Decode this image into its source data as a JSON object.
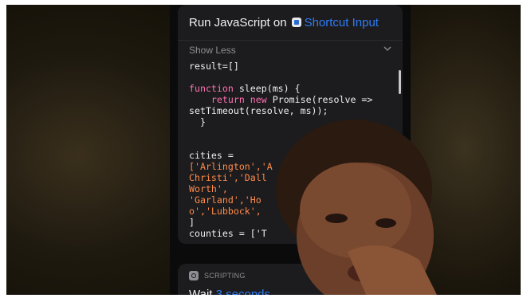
{
  "action": {
    "title_prefix": "Run JavaScript on",
    "input_icon": "shortcut-input-icon",
    "input_label": "Shortcut Input",
    "toggle_label": "Show Less",
    "toggle_icon": "chevron-down-icon"
  },
  "code": {
    "lines": [
      [
        {
          "t": "result=[]"
        }
      ],
      [
        {
          "t": ""
        }
      ],
      [
        {
          "t": "function",
          "c": "kw"
        },
        {
          "t": " sleep(ms) {"
        }
      ],
      [
        {
          "t": "    "
        },
        {
          "t": "return",
          "c": "kw"
        },
        {
          "t": " "
        },
        {
          "t": "new",
          "c": "kw"
        },
        {
          "t": " Promise(resolve =>"
        }
      ],
      [
        {
          "t": "setTimeout(resolve, ms));"
        }
      ],
      [
        {
          "t": "  }"
        }
      ],
      [
        {
          "t": ""
        }
      ],
      [
        {
          "t": ""
        }
      ],
      [
        {
          "t": "cities ="
        }
      ],
      [
        {
          "t": "['Arlington','A",
          "c": "str"
        }
      ],
      [
        {
          "t": "Christi','Dall",
          "c": "str"
        }
      ],
      [
        {
          "t": "Worth',",
          "c": "str"
        }
      ],
      [
        {
          "t": "'Garland','Ho",
          "c": "str"
        }
      ],
      [
        {
          "t": "o','Lubbock',",
          "c": "str"
        }
      ],
      [
        {
          "t": "]"
        }
      ],
      [
        {
          "t": "counties = ['T"
        }
      ]
    ]
  },
  "next_action": {
    "category_icon": "scripting-icon",
    "category": "SCRIPTING",
    "label": "Wait",
    "value": "3 seconds"
  },
  "colors": {
    "link": "#2f7cf6",
    "keyword": "#ff6fb1",
    "string": "#ff8a4a"
  }
}
